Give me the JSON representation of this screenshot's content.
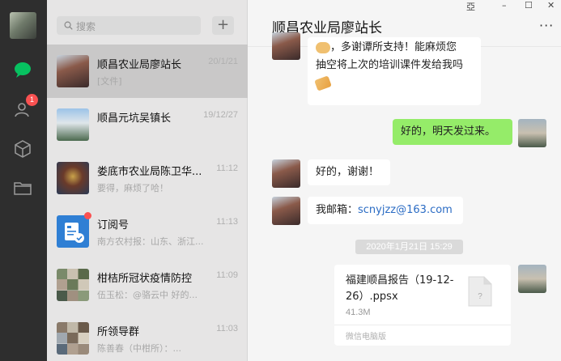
{
  "window": {
    "pin": "亞",
    "minimize": "–",
    "maximize": "☐",
    "close": "✕"
  },
  "search": {
    "placeholder": "搜索"
  },
  "add_button": "+",
  "nav": {
    "contacts_badge": "1"
  },
  "conversations": [
    {
      "name": "顺昌农业局廖站长",
      "time": "20/1/21",
      "preview": "[文件]",
      "active": true
    },
    {
      "name": "顺昌元坑吴镇长",
      "time": "19/12/27",
      "preview": ""
    },
    {
      "name": "娄底市农业局陈卫华...",
      "time": "11:12",
      "preview": "要得，麻烦了哈！"
    },
    {
      "name": "订阅号",
      "time": "11:13",
      "preview": "南方农村报：山东、浙江...",
      "unread_dot": true
    },
    {
      "name": "柑桔所冠状疫情防控",
      "time": "11:09",
      "preview": "伍玉松：@骆云中 好的..."
    },
    {
      "name": "所领导群",
      "time": "11:03",
      "preview": "陈善春（中柑所）：..."
    }
  ],
  "chat": {
    "title": "顺昌农业局廖站长",
    "more": "···",
    "messages": {
      "m1_line1": "，多谢谭所支持！能麻烦您",
      "m1_line2": "抽空将上次的培训课件发给我吗",
      "m2": "好的，明天发过来。",
      "m3": "好的，谢谢！",
      "m4_prefix": "我邮箱：",
      "m4_email": "scnyjzz@163.com"
    },
    "timestamp": "2020年1月21日 15:29",
    "file": {
      "name": "福建顺昌报告（19-12-26）.ppsx",
      "size": "41.3M",
      "source": "微信电脑版"
    }
  },
  "colors": {
    "rail": "#2e2e2e",
    "list_bg": "#e6e5e5",
    "active": "#c9c8c8",
    "green_bubble": "#95ec69",
    "link": "#2b6cc4",
    "badge": "#fa5151"
  }
}
